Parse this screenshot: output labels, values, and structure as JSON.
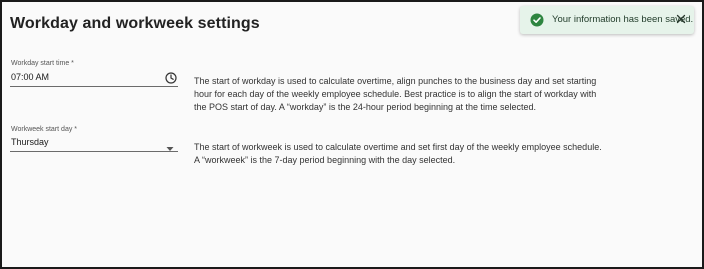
{
  "page": {
    "title": "Workday and workweek settings"
  },
  "toast": {
    "message": "Your information has been saved.",
    "status_color": "#2e8540",
    "icon": "check-circle-icon",
    "close_icon": "close-icon"
  },
  "workday": {
    "label": "Workday start time *",
    "value": "07:00 AM",
    "icon": "clock-icon",
    "description": "The start of workday is used to calculate overtime, align punches to the business day and set starting hour for each day of the weekly employee schedule. Best practice is to align the start of workday with the POS start of day. A “workday” is the 24-hour period beginning at the time selected."
  },
  "workweek": {
    "label": "Workweek start day *",
    "value": "Thursday",
    "icon": "caret-down-icon",
    "description": "The start of workweek is used to calculate overtime and set first day of the weekly employee schedule. A “workweek” is the 7-day period beginning with the day selected."
  }
}
